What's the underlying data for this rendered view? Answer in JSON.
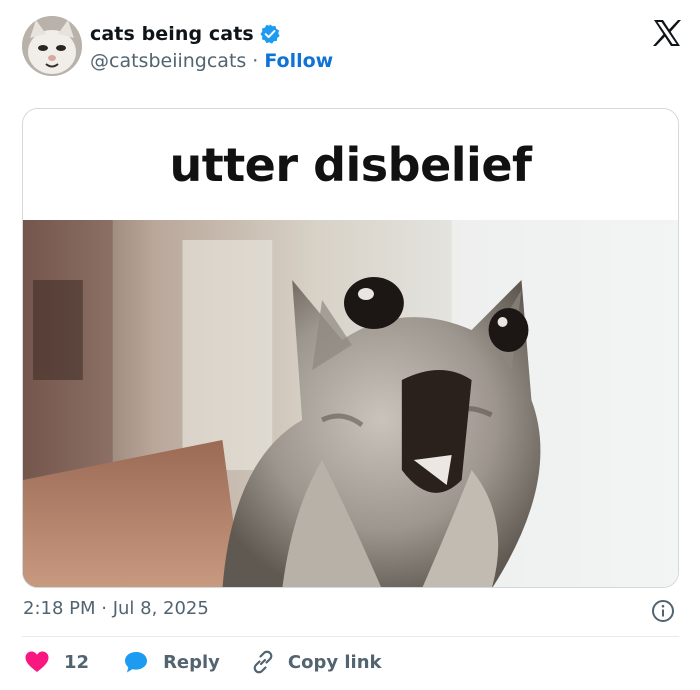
{
  "author": {
    "display_name": "cats being cats",
    "handle": "@catsbeiingcats",
    "separator": "·",
    "follow_label": "Follow",
    "verified": true
  },
  "media": {
    "caption": "utter disbelief"
  },
  "timestamp": "2:18 PM · Jul 8, 2025",
  "actions": {
    "like_count": "12",
    "reply_label": "Reply",
    "copy_link_label": "Copy link"
  },
  "colors": {
    "accent": "#0f73d6",
    "verified_badge": "#1d9bf0",
    "like": "#f91880",
    "muted": "#536471"
  },
  "icons": {
    "platform": "x-logo-icon",
    "verified": "verified-badge-icon",
    "info": "info-icon",
    "like": "heart-icon",
    "reply": "chat-bubble-icon",
    "copy": "link-icon"
  }
}
